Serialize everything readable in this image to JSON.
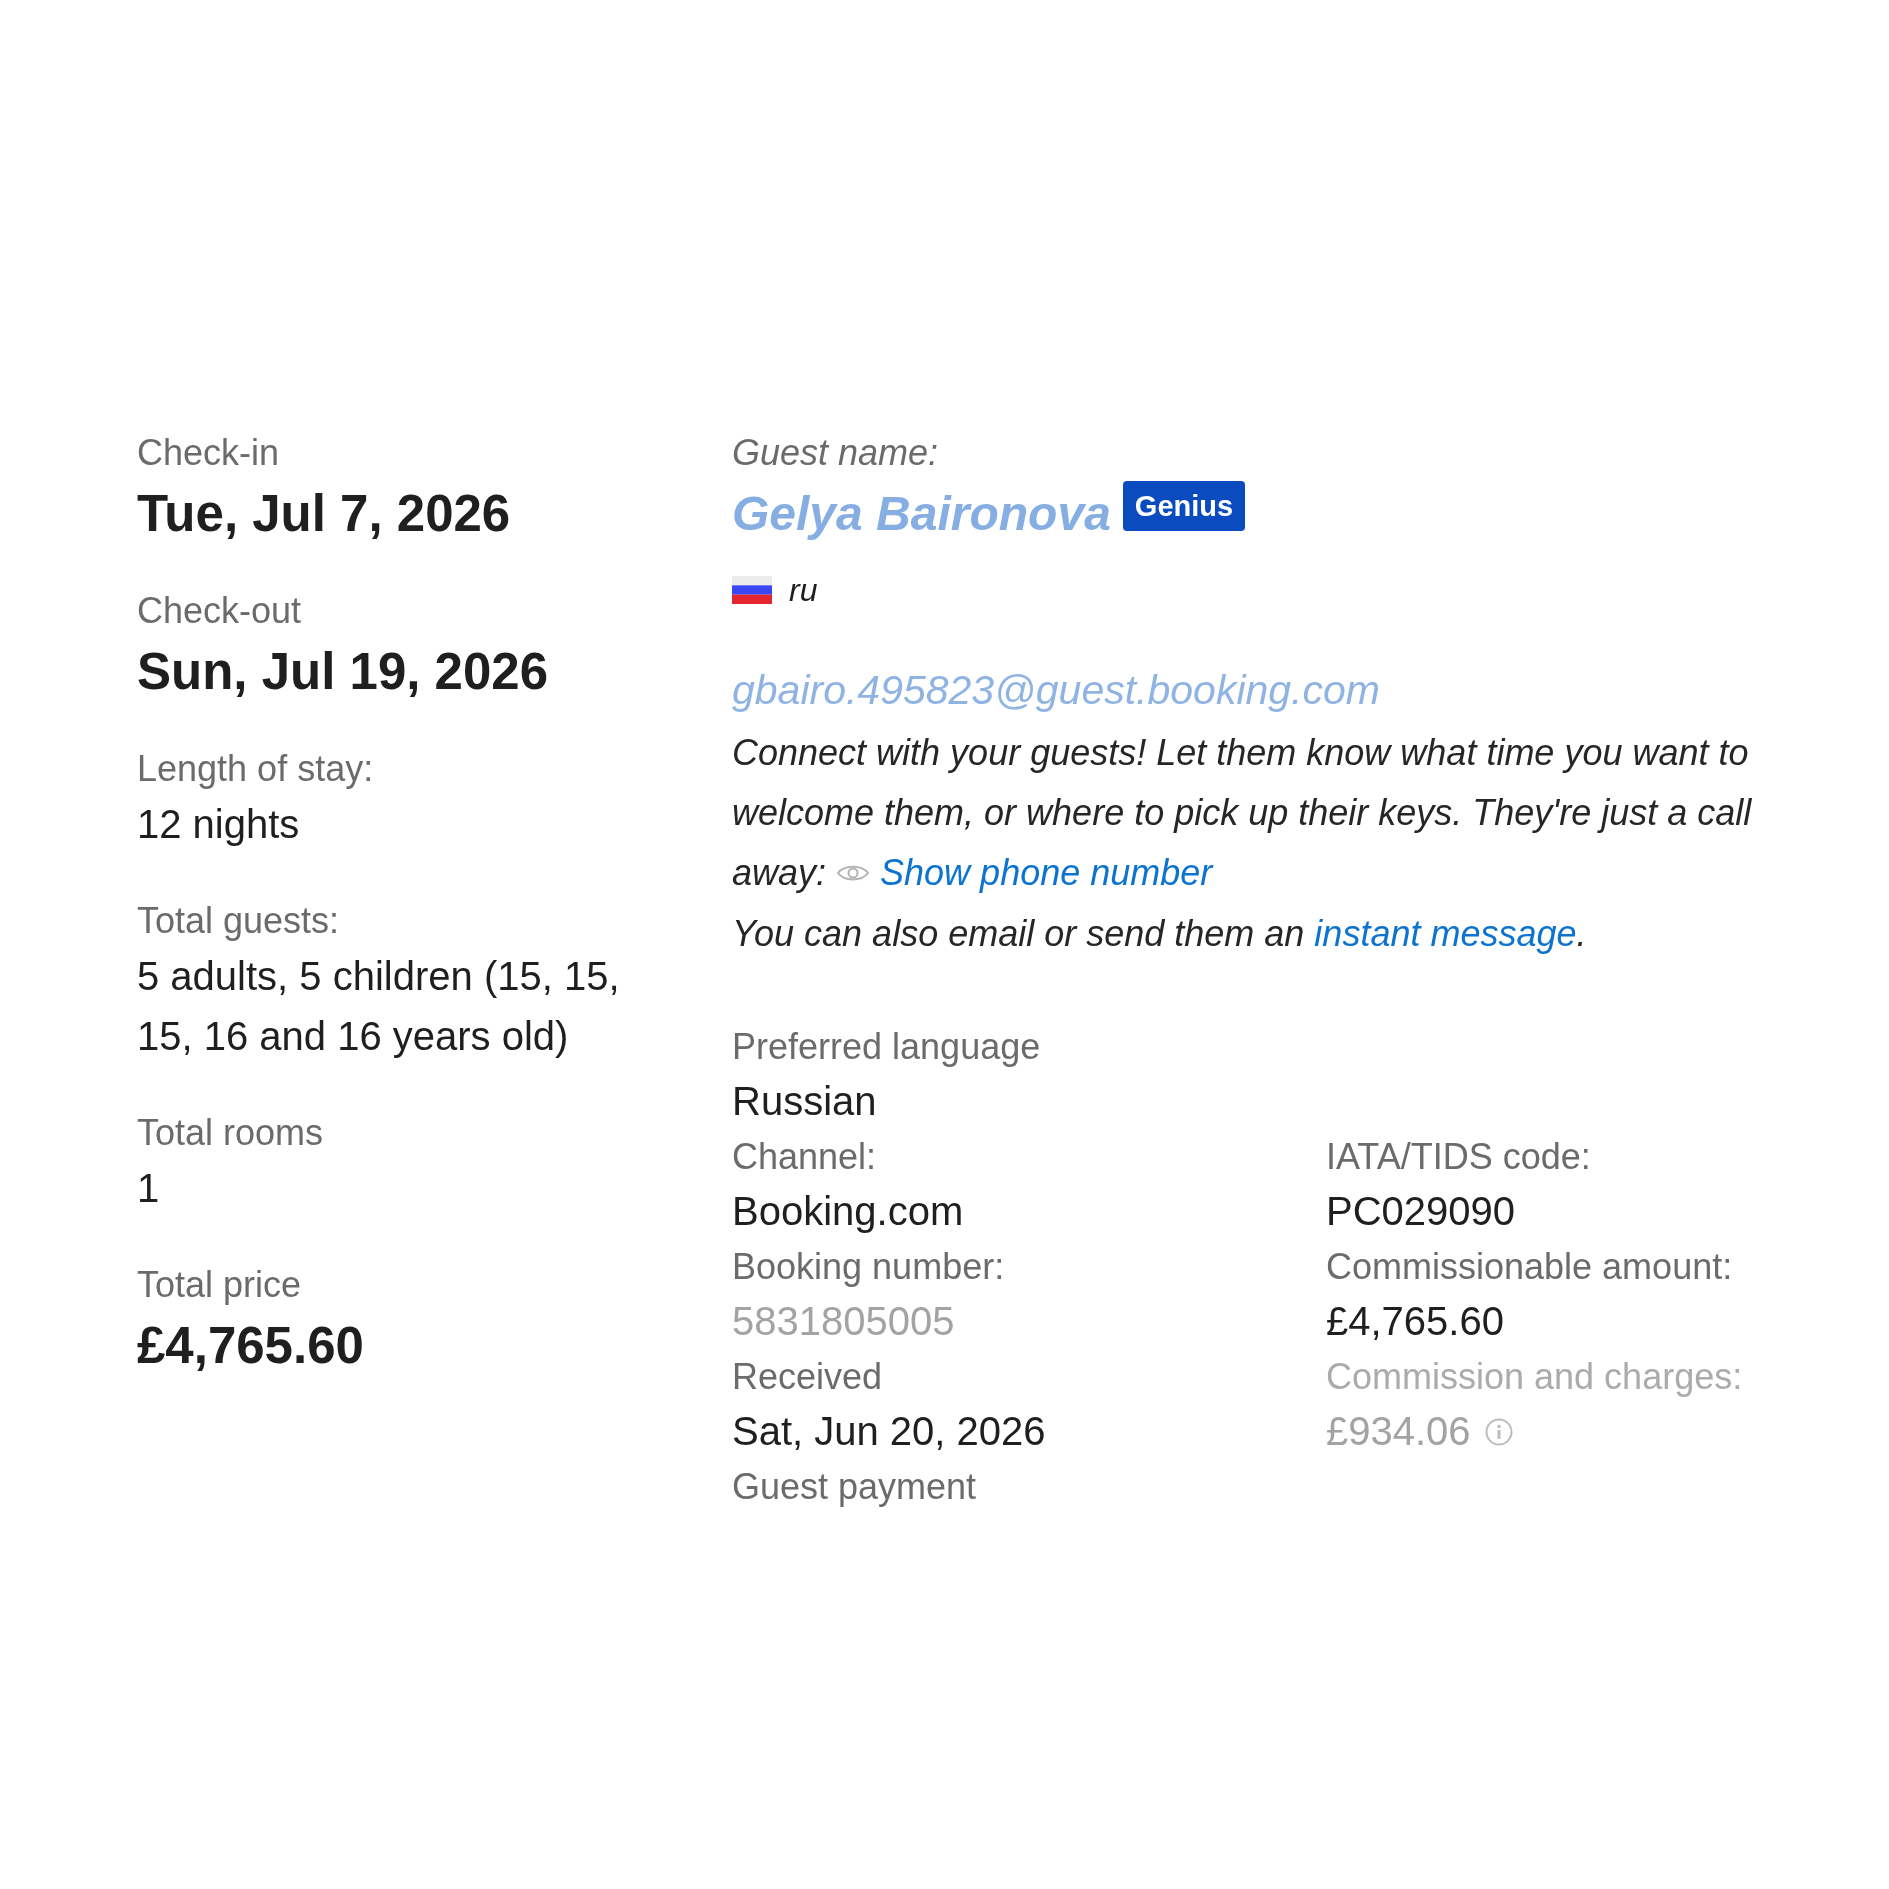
{
  "stay": [
    {
      "label": "Check-in",
      "value": "Tue, Jul 7, 2026",
      "kind": "bold"
    },
    {
      "label": "Check-out",
      "value": "Sun, Jul 19, 2026",
      "kind": "bold"
    },
    {
      "label": "Length of stay:",
      "value": "12 nights",
      "kind": "regular"
    },
    {
      "label": "Total guests:",
      "value": "5 adults, 5 children (15, 15, 15, 16 and 16 years old)",
      "kind": "regular"
    },
    {
      "label": "Total rooms",
      "value": "1",
      "kind": "regular"
    },
    {
      "label": "Total price",
      "value": "£4,765.60",
      "kind": "bold"
    }
  ],
  "guest": {
    "label": "Guest name:",
    "name": "Gelya Baironova",
    "name_faded": true,
    "badge": "Genius",
    "language_code": "ru",
    "email": "gbairo.495823@guest.booking.com",
    "email_faded": true
  },
  "contact": {
    "text": "Connect with your guests! Let them know what time you want to welcome them, or where to pick up their keys. They're just a call away:",
    "phone_link": "Show phone number",
    "message": "You can also email or send them an",
    "message_link": "instant message",
    "message_end": "."
  },
  "preferred_language": {
    "label": "Preferred language",
    "value": "Russian"
  },
  "details": {
    "columns": [
      [
        {
          "label": "Channel:",
          "value": "Booking.com"
        },
        {
          "label": "Booking number:",
          "value": "5831805005",
          "value_faded": true
        },
        {
          "label": "Received",
          "value": "Sat, Jun 20, 2026"
        },
        {
          "label": "Guest payment"
        }
      ],
      [
        {
          "label": "IATA/TIDS code:",
          "value": "PC029090"
        },
        {
          "label": "Commissionable amount:",
          "value": "£4,765.60"
        },
        {
          "label": "Commission and charges:",
          "label_faded": true,
          "value": "£934.06",
          "value_faded": true,
          "info": true
        }
      ]
    ]
  }
}
